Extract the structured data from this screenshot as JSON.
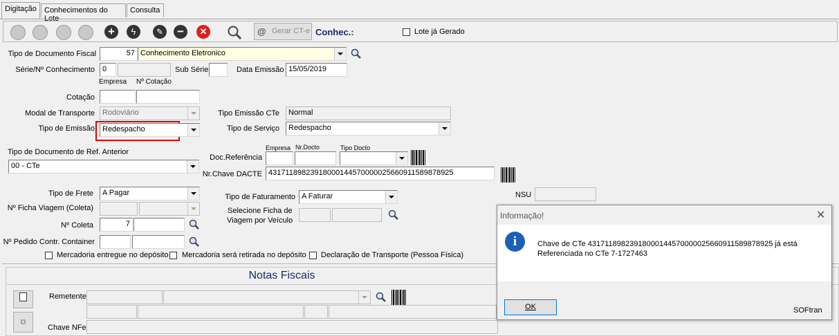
{
  "tabs": [
    "Digitação",
    "Conhecimentos do Lote",
    "Consulta"
  ],
  "toolbar": {
    "gerar_label": "Gerar CT-e",
    "title": "Conhec.:",
    "lote_label": "Lote já Gerado"
  },
  "form": {
    "tipo_doc_label": "Tipo de Documento Fiscal",
    "tipo_doc_code": "57",
    "tipo_doc_value": "Conhecimento Eletronico",
    "serie_label": "Série/Nº Conhecimento",
    "serie_value": "0",
    "sub_serie_label": "Sub Série",
    "data_emissao_label": "Data Emissão",
    "data_emissao_value": "15/05/2019",
    "empresa_label": "Empresa",
    "n_cotacao_label": "Nº Cotação",
    "cotacao_label": "Cotação",
    "modal_label": "Modal de Transporte",
    "modal_value": "Rodoviário",
    "tipo_emissao_cte_label": "Tipo Emissão CTe",
    "tipo_emissao_cte_value": "Normal",
    "tipo_emissao_label": "Tipo de Emissão",
    "tipo_emissao_value": "Redespacho",
    "tipo_servico_label": "Tipo de Serviço",
    "tipo_servico_value": "Redespacho",
    "tipo_doc_ref_label": "Tipo de Documento de Ref. Anterior",
    "tipo_doc_ref_value": "00 - CTe",
    "docref_empresa_label": "Empresa",
    "docref_nrdocto_label": "Nr.Docto",
    "docref_tipodocto_label": "Tipo Docto",
    "doc_referencia_label": "Doc.Referência",
    "nr_chave_label": "Nr.Chave DACTE",
    "nr_chave_value": "43171189823918000144570000025660911589878925",
    "tipo_frete_label": "Tipo de Frete",
    "tipo_frete_value": "A Pagar",
    "tipo_faturamento_label": "Tipo de Faturamento",
    "tipo_faturamento_value": "A Faturar",
    "nsu_label": "NSU",
    "ficha_viagem_label": "Nº Ficha Viagem (Coleta)",
    "selecione_ficha_label_1": "Selecione Ficha de",
    "selecione_ficha_label_2": "Viagem por Veículo",
    "coleta_label": "Nº Coleta",
    "coleta_value": "7",
    "pedido_label": "Nº Pedido Contr. Container",
    "chk_deposito": "Mercadoria entregue no depósito",
    "chk_retirada": "Mercadoria será retirada no depósito",
    "chk_declaracao": "Declaração de Transporte (Pessoa Física)"
  },
  "notas": {
    "title": "Notas Fiscais",
    "remetente_label": "Remetente",
    "chave_nfe_label": "Chave NFe"
  },
  "dialog": {
    "title": "Informação!",
    "message_1": "Chave de CTe 43171189823918000144570000025660911589878925 já está",
    "message_2": "Referenciada no CTe 7-1727463",
    "ok_label": "OK",
    "brand": "SOFtran"
  },
  "colors": {
    "highlight_box": "#e00000",
    "title_blue": "#1a2a6c",
    "info_icon": "#1c5fb8"
  }
}
